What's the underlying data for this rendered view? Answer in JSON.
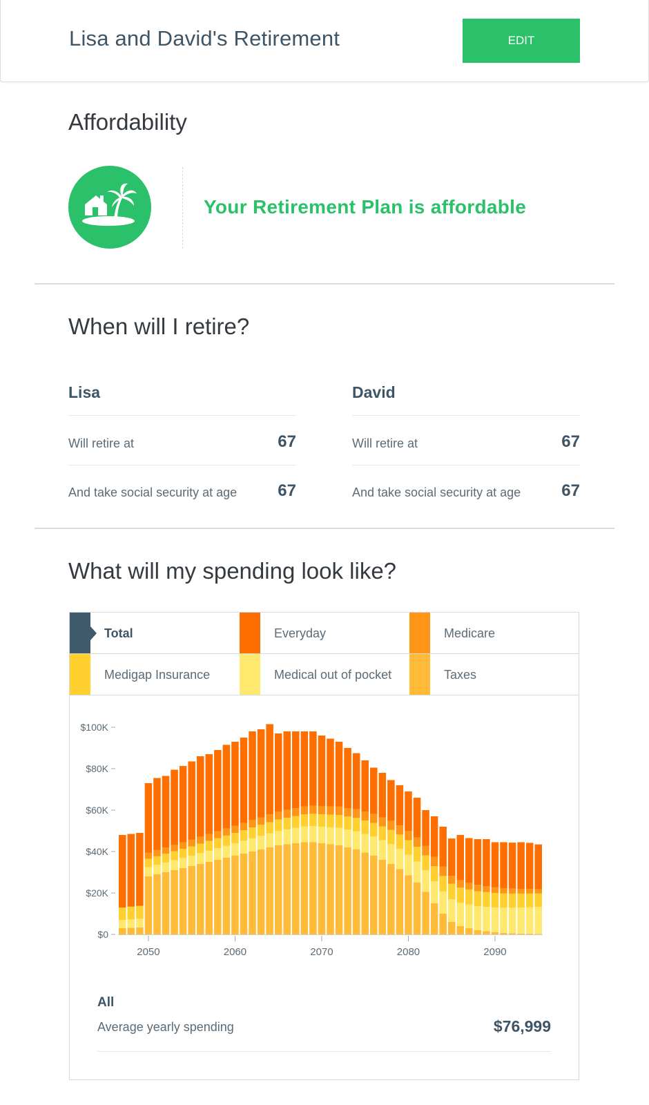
{
  "header": {
    "title": "Lisa and David's Retirement",
    "edit_label": "EDIT",
    "accent_color": "#2bc06a"
  },
  "affordability": {
    "section_title": "Affordability",
    "icon": "island-home-palm-icon",
    "status_text": "Your Retirement Plan is affordable"
  },
  "retire": {
    "section_title": "When will I retire?",
    "people": [
      {
        "name": "Lisa",
        "rows": [
          {
            "label": "Will retire at",
            "value": "67"
          },
          {
            "label": "And take social security at age",
            "value": "67"
          }
        ]
      },
      {
        "name": "David",
        "rows": [
          {
            "label": "Will retire at",
            "value": "67"
          },
          {
            "label": "And take social security at age",
            "value": "67"
          }
        ]
      }
    ]
  },
  "spending": {
    "section_title": "What will my spending look like?",
    "legend": [
      {
        "label": "Total",
        "color": "#3f5a6b",
        "active": true
      },
      {
        "label": "Everyday",
        "color": "#ff6f00",
        "active": false
      },
      {
        "label": "Medicare",
        "color": "#ff9517",
        "active": false
      },
      {
        "label": "Medigap Insurance",
        "color": "#ffd02e",
        "active": false
      },
      {
        "label": "Medical out of pocket",
        "color": "#ffe86e",
        "active": false
      },
      {
        "label": "Taxes",
        "color": "#ffba38",
        "active": false
      }
    ],
    "summary": {
      "title": "All",
      "label": "Average yearly spending",
      "value": "$76,999"
    }
  },
  "chart_data": {
    "type": "bar",
    "stacked": true,
    "x": [
      2047,
      2048,
      2049,
      2050,
      2051,
      2052,
      2053,
      2054,
      2055,
      2056,
      2057,
      2058,
      2059,
      2060,
      2061,
      2062,
      2063,
      2064,
      2065,
      2066,
      2067,
      2068,
      2069,
      2070,
      2071,
      2072,
      2073,
      2074,
      2075,
      2076,
      2077,
      2078,
      2079,
      2080,
      2081,
      2082,
      2083,
      2084,
      2085,
      2086,
      2087,
      2088,
      2089,
      2090,
      2091,
      2092,
      2093,
      2094,
      2095
    ],
    "x_ticks": [
      "2050",
      "2060",
      "2070",
      "2080",
      "2090"
    ],
    "y_ticks": [
      "$0",
      "$20K",
      "$40K",
      "$60K",
      "$80K",
      "$100K"
    ],
    "ylim": [
      0,
      100000
    ],
    "series": [
      {
        "name": "Taxes",
        "color": "#ffba38",
        "values": [
          3000,
          3200,
          3400,
          28000,
          29000,
          30000,
          31000,
          32000,
          33000,
          34000,
          35000,
          36000,
          37000,
          38000,
          39000,
          40000,
          41000,
          42000,
          43000,
          43500,
          44000,
          44500,
          44500,
          44000,
          43500,
          43000,
          42000,
          41000,
          39500,
          38000,
          36000,
          34000,
          31500,
          28500,
          25000,
          20500,
          15000,
          10000,
          6000,
          4000,
          3000,
          2000,
          1500,
          1000,
          700,
          500,
          400,
          300,
          250
        ]
      },
      {
        "name": "Medical out of pocket",
        "color": "#ffe86e",
        "values": [
          4000,
          4100,
          4200,
          4500,
          4600,
          4700,
          4800,
          4900,
          5000,
          5200,
          5400,
          5600,
          5800,
          6000,
          6200,
          6400,
          6600,
          6800,
          7000,
          7200,
          7400,
          7600,
          7800,
          8000,
          8200,
          8400,
          8600,
          8800,
          9000,
          9200,
          9400,
          9600,
          9800,
          10000,
          10200,
          10400,
          10600,
          10800,
          11000,
          11200,
          11400,
          11600,
          11800,
          12000,
          12200,
          12400,
          12600,
          12800,
          13000
        ]
      },
      {
        "name": "Medigap Insurance",
        "color": "#ffd02e",
        "values": [
          6000,
          6100,
          6200,
          4000,
          4100,
          4200,
          4300,
          4400,
          4500,
          4600,
          4700,
          4800,
          4900,
          5000,
          5100,
          5200,
          5300,
          5400,
          5500,
          5600,
          5700,
          5800,
          5900,
          6000,
          6100,
          6200,
          6300,
          6400,
          6500,
          6600,
          6700,
          6800,
          6900,
          7000,
          7100,
          7200,
          7300,
          7400,
          7500,
          7400,
          7300,
          7200,
          7100,
          7000,
          6900,
          6800,
          6700,
          6600,
          6500
        ]
      },
      {
        "name": "Medicare",
        "color": "#ff9517",
        "values": [
          0,
          0,
          0,
          3000,
          3000,
          3100,
          3100,
          3200,
          3200,
          3300,
          3300,
          3400,
          3400,
          3500,
          3500,
          3600,
          3600,
          3700,
          3700,
          3800,
          3800,
          3900,
          3900,
          4000,
          4000,
          4100,
          4100,
          4200,
          4200,
          4300,
          4300,
          4400,
          4400,
          4500,
          4500,
          4600,
          4600,
          4500,
          3800,
          3500,
          3300,
          3100,
          2900,
          2700,
          2500,
          2400,
          2300,
          2200,
          2100
        ]
      },
      {
        "name": "Everyday",
        "color": "#ff6f00",
        "values": [
          35000,
          35100,
          35200,
          33500,
          34800,
          34500,
          36300,
          36800,
          37800,
          38900,
          38600,
          39200,
          40400,
          40500,
          41200,
          42800,
          42500,
          43600,
          37800,
          37900,
          37100,
          36200,
          35900,
          34000,
          32700,
          31300,
          29000,
          27100,
          24800,
          22400,
          21600,
          19700,
          19400,
          19000,
          19200,
          17300,
          19500,
          19300,
          18000,
          21900,
          21500,
          22100,
          22700,
          21800,
          22200,
          22200,
          22500,
          22300,
          21600
        ]
      }
    ]
  }
}
